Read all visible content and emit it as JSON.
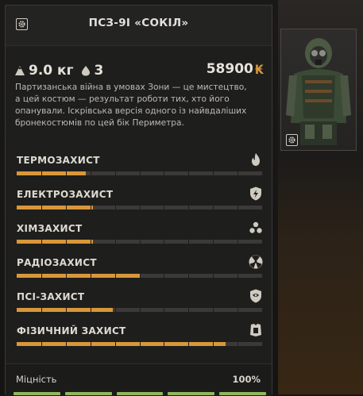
{
  "item": {
    "title": "ПСЗ-9І «СОКІЛ»",
    "weight": "9.0 кг",
    "artifact_slots": "3",
    "price": "58900",
    "currency_symbol": "₭",
    "description": "Партизанська війна в умовах Зони — це мистецтво, а цей костюм — результат роботи тих, хто його опанували. Іскрівська версія одного із найвдаліших бронекостюмів по цей бік Периметра."
  },
  "protections": [
    {
      "label": "ТЕРМОЗАХИСТ",
      "icon": "fire-icon",
      "level": 0.28
    },
    {
      "label": "ЕЛЕКТРОЗАХИСТ",
      "icon": "lightning-shield-icon",
      "level": 0.31
    },
    {
      "label": "ХІМЗАХИСТ",
      "icon": "biohazard-icon",
      "level": 0.31
    },
    {
      "label": "РАДІОЗАХИСТ",
      "icon": "radiation-icon",
      "level": 0.5
    },
    {
      "label": "ПСІ-ЗАХИСТ",
      "icon": "psi-shield-icon",
      "level": 0.39
    },
    {
      "label": "ФІЗИЧНИЙ ЗАХИСТ",
      "icon": "body-armor-icon",
      "level": 0.85
    }
  ],
  "durability": {
    "label": "Міцність",
    "value": "100%",
    "level": 1.0
  },
  "colors": {
    "accent": "#d9973a",
    "durability": "#8fb85d",
    "panel": "#1e1e1d"
  }
}
